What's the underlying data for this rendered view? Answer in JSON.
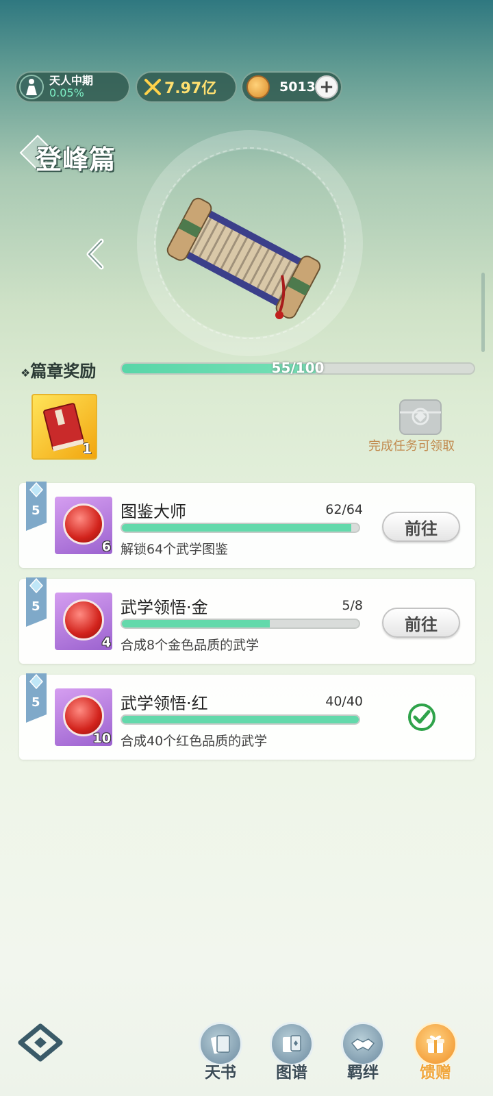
{
  "status": {
    "realm_name": "天人中期",
    "realm_progress": "0.05%",
    "power": "7.97亿",
    "currency": "5013",
    "add_label": "+"
  },
  "chapter": {
    "title": "登峰篇"
  },
  "reward": {
    "label": "篇章奖励",
    "progress_text": "55/100",
    "progress_fraction": 0.55,
    "item_count": "1",
    "claim_hint": "完成任务可领取"
  },
  "tasks": [
    {
      "rank": "5",
      "icon_count": "6",
      "title": "图鉴大师",
      "progress_text": "62/64",
      "progress_fraction": 0.969,
      "desc": "解锁64个武学图鉴",
      "action": "前往",
      "done": false
    },
    {
      "rank": "5",
      "icon_count": "4",
      "title": "武学领悟·金",
      "progress_text": "5/8",
      "progress_fraction": 0.625,
      "desc": "合成8个金色品质的武学",
      "action": "前往",
      "done": false
    },
    {
      "rank": "5",
      "icon_count": "10",
      "title": "武学领悟·红",
      "progress_text": "40/40",
      "progress_fraction": 1.0,
      "desc": "合成40个红色品质的武学",
      "action": "",
      "done": true
    }
  ],
  "nav": {
    "items": [
      {
        "label": "天书",
        "icon": "book-cards-icon",
        "active": false
      },
      {
        "label": "图谱",
        "icon": "cards-icon",
        "active": false
      },
      {
        "label": "羁绊",
        "icon": "handshake-icon",
        "active": false
      },
      {
        "label": "馈赠",
        "icon": "gift-icon",
        "active": true
      }
    ]
  },
  "colors": {
    "accent_green": "#63d9ab",
    "active_orange": "#f0a63b",
    "hint_brown": "#c18a4e"
  }
}
